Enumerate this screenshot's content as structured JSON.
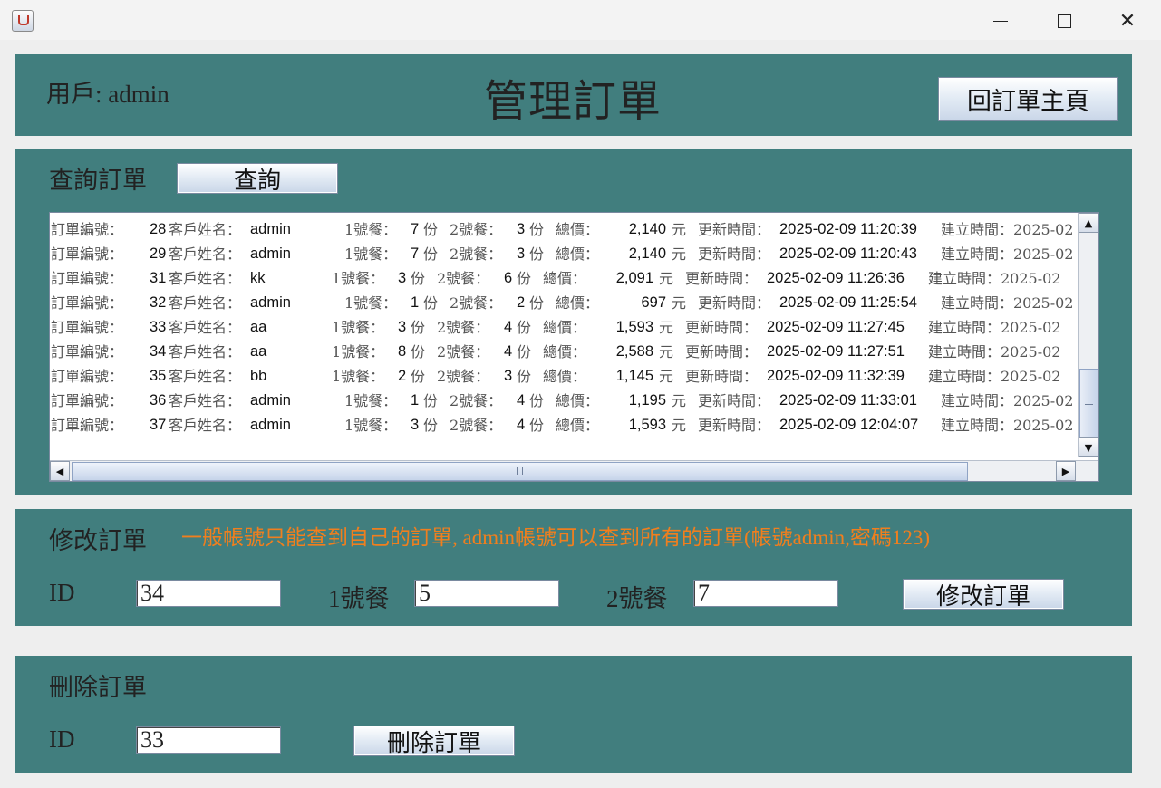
{
  "window": {
    "app_icon": "java-cup-icon",
    "controls": {
      "minimize": "─",
      "maximize": "☐",
      "close": "✕"
    }
  },
  "header": {
    "user_label": "用戶: admin",
    "title": "管理訂單",
    "back_button": "回訂單主頁"
  },
  "query": {
    "label": "查詢訂單",
    "button": "查詢",
    "orders": [
      {
        "no": "28",
        "name": "admin",
        "m1": "7",
        "m2": "3",
        "total": "2,140",
        "updated": "2025-02-09 11:20:39"
      },
      {
        "no": "29",
        "name": "admin",
        "m1": "7",
        "m2": "3",
        "total": "2,140",
        "updated": "2025-02-09 11:20:43"
      },
      {
        "no": "31",
        "name": "kk",
        "m1": "3",
        "m2": "6",
        "total": "2,091",
        "updated": "2025-02-09 11:26:36"
      },
      {
        "no": "32",
        "name": "admin",
        "m1": "1",
        "m2": "2",
        "total": "697",
        "updated": "2025-02-09 11:25:54"
      },
      {
        "no": "33",
        "name": "aa",
        "m1": "3",
        "m2": "4",
        "total": "1,593",
        "updated": "2025-02-09 11:27:45"
      },
      {
        "no": "34",
        "name": "aa",
        "m1": "8",
        "m2": "4",
        "total": "2,588",
        "updated": "2025-02-09 11:27:51"
      },
      {
        "no": "35",
        "name": "bb",
        "m1": "2",
        "m2": "3",
        "total": "1,145",
        "updated": "2025-02-09 11:32:39"
      },
      {
        "no": "36",
        "name": "admin",
        "m1": "1",
        "m2": "4",
        "total": "1,195",
        "updated": "2025-02-09 11:33:01"
      },
      {
        "no": "37",
        "name": "admin",
        "m1": "3",
        "m2": "4",
        "total": "1,593",
        "updated": "2025-02-09 12:04:07"
      }
    ],
    "row_labels": {
      "order_no": "訂單編號：",
      "customer": "客戶姓名：",
      "meal1": "1號餐：",
      "meal2": "2號餐：",
      "portion": "份",
      "total": "總價：",
      "currency": "元",
      "updated": "更新時間：",
      "created": "建立時間：2025-02"
    }
  },
  "edit": {
    "label": "修改訂單",
    "notice": "一般帳號只能查到自己的訂單, admin帳號可以查到所有的訂單(帳號admin,密碼123)",
    "id_label": "ID",
    "id_value": "34",
    "meal1_label": "1號餐",
    "meal1_value": "5",
    "meal2_label": "2號餐",
    "meal2_value": "7",
    "button": "修改訂單"
  },
  "delete": {
    "label": "刪除訂單",
    "id_label": "ID",
    "id_value": "33",
    "button": "刪除訂單"
  }
}
